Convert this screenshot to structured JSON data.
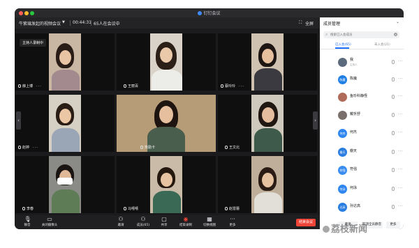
{
  "window": {
    "title": "钉钉会议"
  },
  "meeting": {
    "name": "牛紫璃发起的视频会议",
    "timer": "00:44:31",
    "count_text": "65人在会议中",
    "fullscreen_label": "全屏"
  },
  "grid": {
    "recording_badge": "主持人录制中",
    "tiles": [
      {
        "name": "薛上博"
      },
      {
        "name": "王丽百"
      },
      {
        "name": "蔡玲玲"
      },
      {
        "name": "赵婷"
      },
      {
        "name": "熊勤卡"
      },
      {
        "name": "王文北"
      },
      {
        "name": "李春"
      },
      {
        "name": "马嘻嘻"
      },
      {
        "name": "赵雷蕾"
      }
    ]
  },
  "toolbar": {
    "mute": "静音",
    "camera": "关闭摄像头",
    "invite": "邀请",
    "members": "成员(65)",
    "share": "共享",
    "record": "结束录制",
    "view": "切换视图",
    "more": "更多",
    "end": "结束会议"
  },
  "panel": {
    "title": "成员管理",
    "search_placeholder": "搜索已入会成员",
    "tab_joined": "已入会(65)",
    "tab_not_joined": "未入会(21)",
    "members": [
      {
        "name": "我",
        "sub": "主持人",
        "avatar_text": "",
        "color": "#5b6b7d"
      },
      {
        "name": "陈魔",
        "avatar_text": "陈魔",
        "color": "#1f7fe5"
      },
      {
        "name": "鱼珍科静怪",
        "avatar_text": "",
        "color": "#b06a5a"
      },
      {
        "name": "戴忻舒",
        "avatar_text": "",
        "color": "#7a6f6a"
      },
      {
        "name": "何杰",
        "avatar_text": "何杰",
        "color": "#2f86f0"
      },
      {
        "name": "瓣天",
        "avatar_text": "瓣天",
        "color": "#2a7de1"
      },
      {
        "name": "符强",
        "avatar_text": "符强",
        "color": "#3a8df0"
      },
      {
        "name": "何泳",
        "avatar_text": "何泳",
        "color": "#2f86f0"
      },
      {
        "name": "孙达高",
        "avatar_text": "达高",
        "color": "#2a7de1"
      }
    ],
    "btn_invite": "邀请",
    "btn_mute_all": "取消全员静音",
    "btn_more": "更多"
  },
  "watermark": {
    "text": "荔枝新闻"
  }
}
